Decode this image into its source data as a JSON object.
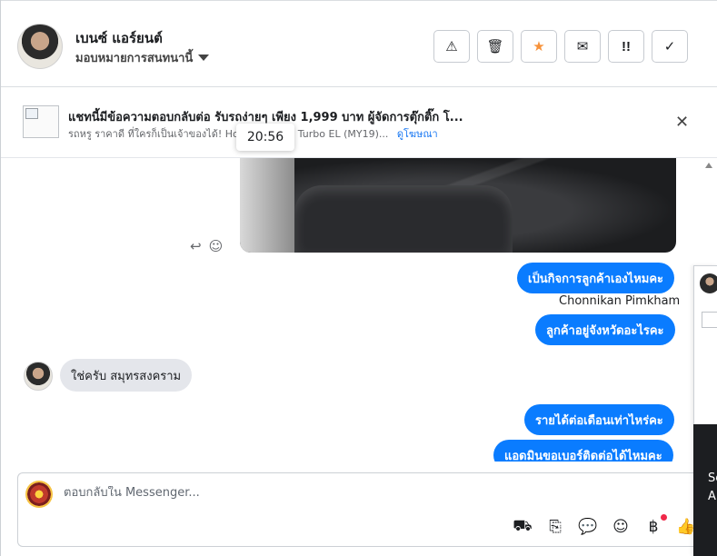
{
  "header": {
    "contact_name": "เบนซ์ แอร์ยนต์",
    "assign_label": "มอบหมายการสนทนานี้",
    "actions": [
      {
        "icon": "warning-icon",
        "glyph": "⚠"
      },
      {
        "icon": "trash-icon",
        "glyph": "🗑"
      },
      {
        "icon": "star-icon",
        "glyph": "★"
      },
      {
        "icon": "mail-icon",
        "glyph": "✉"
      },
      {
        "icon": "follow-up-icon",
        "glyph": "!!"
      },
      {
        "icon": "check-icon",
        "glyph": "✓"
      }
    ]
  },
  "ad": {
    "title": "แชทนี้มีข้อความตอบกลับต่อ รับรถง่ายๆ เพียง 1,999 บาท ผู้จัดการตุ๊กติ๊ก โ...",
    "subtitle": "รถหรู ราคาดี ที่ใครก็เป็นเจ้าของได้! Ho",
    "subtitle_tail": "1.5 Turbo EL (MY19)...",
    "link": "ดูโฆษณา",
    "close_glyph": "✕",
    "tooltip_time": "20:56"
  },
  "messages": {
    "out_1": "เป็นกิจการลูกค้าเองไหมคะ",
    "sender": "Chonnikan Pimkham",
    "out_2": "ลูกค้าอยู่จังหวัดอะไรคะ",
    "in_1": "ใช่ครับ สมุทรสงคราม",
    "out_3": "รายได้ต่อเดือนเท่าไหร่คะ",
    "out_4": "แอดมินขอเบอร์ติดต่อได้ไหมคะ"
  },
  "composer": {
    "placeholder": "ตอบกลับใน Messenger..."
  },
  "side": {
    "line1": "Se",
    "line2": "A"
  },
  "colors": {
    "accent": "#0a7cff",
    "star": "#f7923a",
    "badge": "#f02849"
  }
}
